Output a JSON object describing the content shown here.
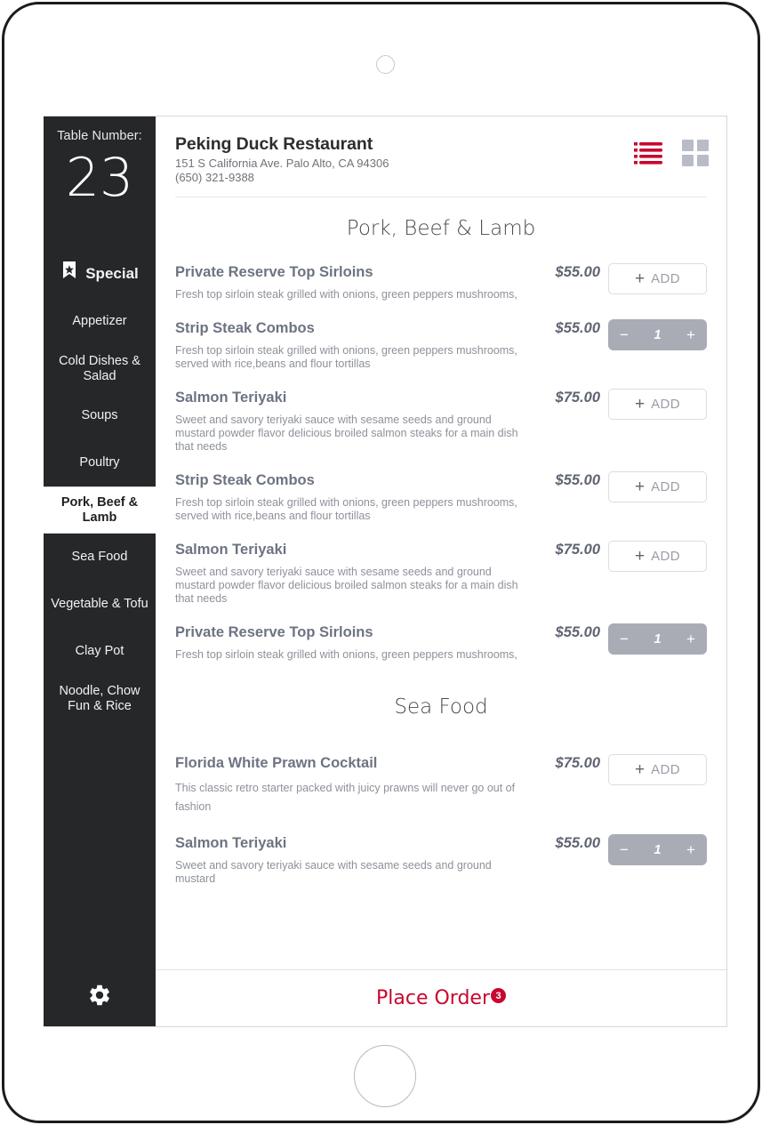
{
  "device": {
    "camera_icon": "camera-dot",
    "home_button_icon": "home-button"
  },
  "sidebar": {
    "table_number_label": "Table Number:",
    "table_number_value": "23",
    "settings_icon": "gear-icon",
    "items": [
      {
        "label": "Special",
        "icon": "ribbon-star-icon",
        "active": false
      },
      {
        "label": "Appetizer",
        "active": false
      },
      {
        "label": "Cold Dishes & Salad",
        "active": false
      },
      {
        "label": "Soups",
        "active": false
      },
      {
        "label": "Poultry",
        "active": false
      },
      {
        "label": "Pork, Beef & Lamb",
        "active": true
      },
      {
        "label": "Sea Food",
        "active": false
      },
      {
        "label": "Vegetable & Tofu",
        "active": false
      },
      {
        "label": "Clay Pot",
        "active": false
      },
      {
        "label": "Noodle, Chow Fun & Rice",
        "active": false
      }
    ]
  },
  "header": {
    "title": "Peking Duck Restaurant",
    "address": "151 S California Ave. Palo Alto, CA 94306",
    "phone": "(650) 321-9388",
    "view_list_icon": "list-view-icon",
    "view_grid_icon": "grid-view-icon",
    "view_list_color": "#c9062f",
    "view_grid_color": "#b9bcc7"
  },
  "menu": {
    "sections": [
      {
        "title": "Pork, Beef & Lamb",
        "items": [
          {
            "name": "Private Reserve Top Sirloins",
            "description": "Fresh top sirloin steak grilled with onions, green peppers mushrooms,",
            "price": "$55.00",
            "control": "add",
            "add_label": "ADD",
            "quantity": ""
          },
          {
            "name": "Strip Steak Combos",
            "description": "Fresh top sirloin steak grilled with onions, green peppers mushrooms, served with rice,beans and flour tortillas",
            "price": "$55.00",
            "control": "stepper",
            "add_label": "ADD",
            "quantity": "1"
          },
          {
            "name": "Salmon Teriyaki",
            "description": "Sweet and savory teriyaki sauce with sesame seeds and ground mustard powder flavor delicious broiled salmon steaks for a main dish that needs",
            "price": "$75.00",
            "control": "add",
            "add_label": "ADD",
            "quantity": ""
          },
          {
            "name": "Strip Steak Combos",
            "description": "Fresh top sirloin steak grilled with onions, green peppers mushrooms, served with rice,beans and flour tortillas",
            "price": "$55.00",
            "control": "add",
            "add_label": "ADD",
            "quantity": ""
          },
          {
            "name": "Salmon Teriyaki",
            "description": "Sweet and savory teriyaki sauce with sesame seeds and ground mustard powder flavor delicious broiled salmon steaks for a main dish that needs",
            "price": "$75.00",
            "control": "add",
            "add_label": "ADD",
            "quantity": ""
          },
          {
            "name": "Private Reserve Top Sirloins",
            "description": "Fresh top sirloin steak grilled with onions, green peppers mushrooms,",
            "price": "$55.00",
            "control": "stepper",
            "add_label": "ADD",
            "quantity": "1"
          }
        ]
      },
      {
        "title": "Sea Food",
        "items": [
          {
            "name": "Florida White Prawn Cocktail",
            "description": "This classic retro starter packed with juicy prawns will never go out of fashion",
            "price": "$75.00",
            "control": "add",
            "add_label": "ADD",
            "quantity": "",
            "loose_lines": true
          },
          {
            "name": "Salmon Teriyaki",
            "description": "Sweet and savory teriyaki sauce with sesame seeds and ground mustard",
            "price": "$55.00",
            "control": "stepper",
            "add_label": "ADD",
            "quantity": "1"
          }
        ]
      }
    ]
  },
  "footer": {
    "place_order_label": "Place Order",
    "order_badge_count": "3",
    "accent_color": "#c9062f"
  }
}
